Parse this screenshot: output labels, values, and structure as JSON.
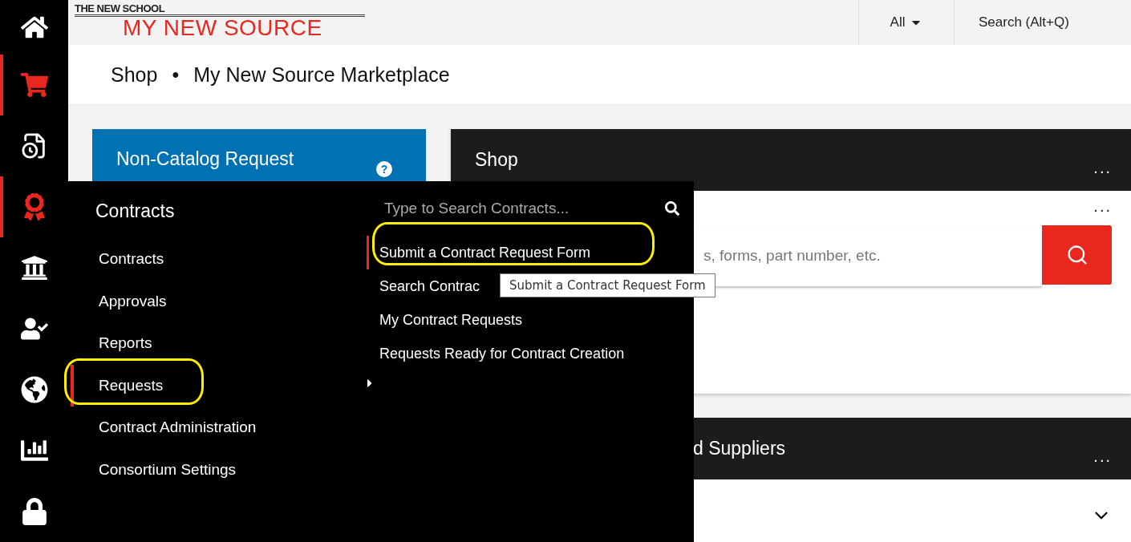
{
  "rail": [
    {
      "kind": "home",
      "active": false
    },
    {
      "kind": "cart",
      "active": true
    },
    {
      "kind": "document-clock",
      "active": false
    },
    {
      "kind": "award",
      "active": true
    },
    {
      "kind": "bank",
      "active": false
    },
    {
      "kind": "users",
      "active": false
    },
    {
      "kind": "globe",
      "active": false
    },
    {
      "kind": "chart",
      "active": false
    },
    {
      "kind": "lock",
      "active": false
    }
  ],
  "logo": {
    "top": "THE NEW SCHOOL",
    "main": "MY NEW SOURCE"
  },
  "topbar": {
    "scope": "All",
    "search": "Search (Alt+Q)"
  },
  "breadcrumb": [
    "Shop",
    "•",
    "My New Source Marketplace"
  ],
  "card": {
    "title": "Non-Catalog Request",
    "help": "?"
  },
  "shop_panel": {
    "title": "Shop",
    "more": "...",
    "body_more": "...",
    "search_placeholder": "s, forms, part number, etc."
  },
  "second_panel": {
    "title": "d Suppliers",
    "more": "..."
  },
  "flyout": {
    "title": "Contracts",
    "items": [
      {
        "label": "Contracts",
        "selected": false
      },
      {
        "label": "Approvals",
        "selected": false
      },
      {
        "label": "Reports",
        "selected": false
      },
      {
        "label": "Requests",
        "selected": true
      },
      {
        "label": "Contract Administration",
        "selected": false
      },
      {
        "label": "Consortium Settings",
        "selected": false
      }
    ],
    "search_placeholder": "Type to Search Contracts...",
    "subitems": [
      {
        "label": "Submit a Contract Request Form",
        "selected": true
      },
      {
        "label": "Search Contrac",
        "selected": false
      },
      {
        "label": "My Contract Requests",
        "selected": false
      },
      {
        "label": "Requests Ready for Contract Creation",
        "selected": false
      }
    ]
  },
  "tooltip": "Submit a Contract Request Form"
}
